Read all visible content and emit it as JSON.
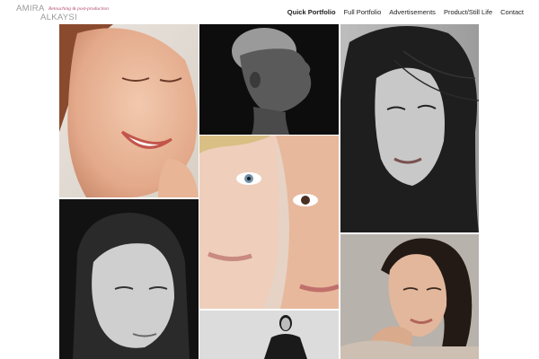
{
  "brand": {
    "name_line1": "AMIRA",
    "name_line2": "ALKAYSI",
    "tagline": "Retouching & post-production"
  },
  "nav": {
    "items": [
      {
        "label": "Quick Portfolio",
        "active": true
      },
      {
        "label": "Full Portfolio",
        "active": false
      },
      {
        "label": "Advertisements",
        "active": false
      },
      {
        "label": "Product/Still Life",
        "active": false
      },
      {
        "label": "Contact",
        "active": false
      }
    ]
  },
  "gallery": {
    "tiles": [
      {
        "subject": "smiling-freckled-woman-color"
      },
      {
        "subject": "short-hair-profile-bw"
      },
      {
        "subject": "windswept-hair-portrait-bw"
      },
      {
        "subject": "two-faces-closeup-color"
      },
      {
        "subject": "slicked-hair-portrait-bw"
      },
      {
        "subject": "smiling-woman-hand-on-chin-color"
      },
      {
        "subject": "woman-dark-jacket-bw"
      }
    ]
  }
}
